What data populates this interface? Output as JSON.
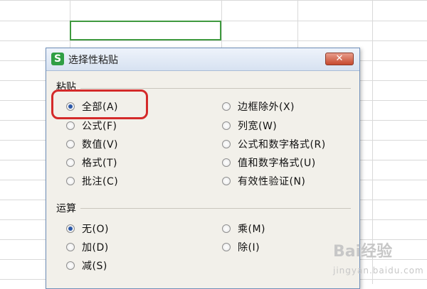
{
  "dialog": {
    "title": "选择性粘贴",
    "app_icon": "S",
    "close_symbol": "✕"
  },
  "paste_group": {
    "label": "粘贴",
    "options": [
      {
        "label": "全部(A)",
        "checked": true
      },
      {
        "label": "公式(F)",
        "checked": false
      },
      {
        "label": "数值(V)",
        "checked": false
      },
      {
        "label": "格式(T)",
        "checked": false
      },
      {
        "label": "批注(C)",
        "checked": false
      },
      {
        "label": "边框除外(X)",
        "checked": false
      },
      {
        "label": "列宽(W)",
        "checked": false
      },
      {
        "label": "公式和数字格式(R)",
        "checked": false
      },
      {
        "label": "值和数字格式(U)",
        "checked": false
      },
      {
        "label": "有效性验证(N)",
        "checked": false
      }
    ]
  },
  "operation_group": {
    "label": "运算",
    "options": [
      {
        "label": "无(O)",
        "checked": true
      },
      {
        "label": "加(D)",
        "checked": false
      },
      {
        "label": "减(S)",
        "checked": false
      },
      {
        "label": "乘(M)",
        "checked": false
      },
      {
        "label": "除(I)",
        "checked": false
      }
    ]
  },
  "watermark": {
    "brand": "Bai经验",
    "url": "jingyan.baidu.com"
  },
  "colors": {
    "selection_border": "#3f9a3f",
    "highlight": "#d42a2a",
    "radio_dot": "#2b58a8",
    "app_icon": "#2f9e44"
  }
}
